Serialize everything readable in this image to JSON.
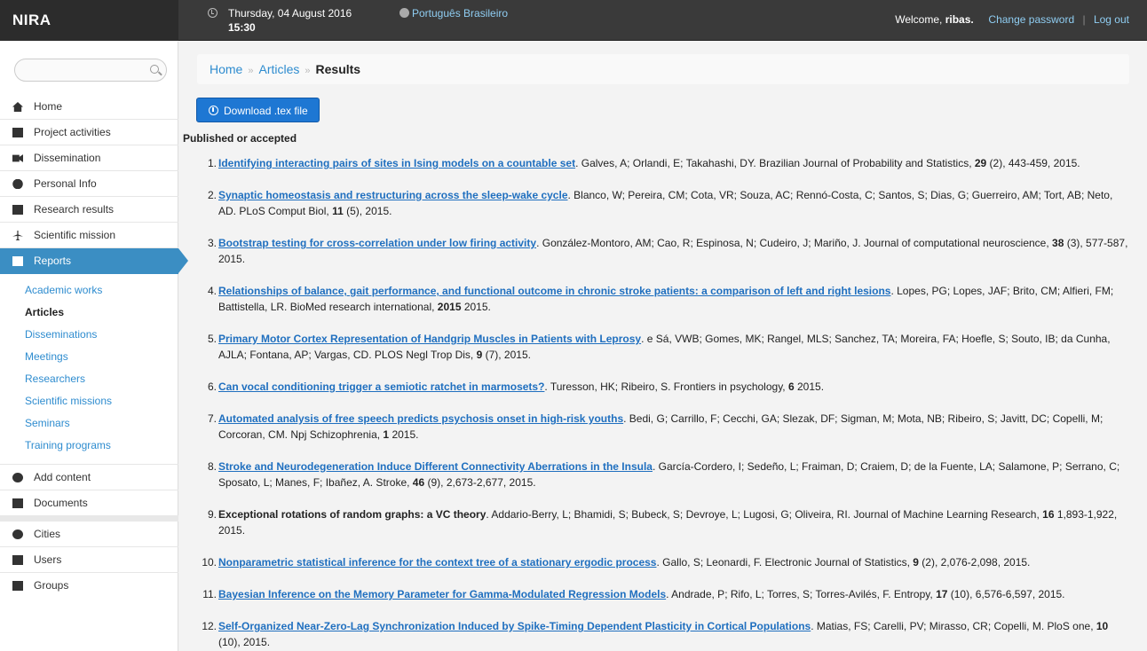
{
  "header": {
    "brand": "NIRA",
    "date": "Thursday, 04 August 2016",
    "time": "15:30",
    "language": "Português Brasileiro",
    "welcome": "Welcome,",
    "username": "ribas.",
    "change_password": "Change password",
    "separator": "|",
    "logout": "Log out"
  },
  "sidebar": {
    "search_placeholder": "",
    "items": [
      {
        "label": "Home",
        "icon": "home-icon"
      },
      {
        "label": "Project activities",
        "icon": "calendar-icon"
      },
      {
        "label": "Dissemination",
        "icon": "video-camera-icon"
      },
      {
        "label": "Personal Info",
        "icon": "user-icon"
      },
      {
        "label": "Research results",
        "icon": "book-icon"
      },
      {
        "label": "Scientific mission",
        "icon": "plane-icon"
      },
      {
        "label": "Reports",
        "icon": "grid-icon"
      }
    ],
    "sub_items": [
      "Academic works",
      "Articles",
      "Disseminations",
      "Meetings",
      "Researchers",
      "Scientific missions",
      "Seminars",
      "Training programs"
    ],
    "items2": [
      {
        "label": "Add content",
        "icon": "plus-circle-icon"
      },
      {
        "label": "Documents",
        "icon": "document-icon"
      }
    ],
    "items3": [
      {
        "label": "Cities",
        "icon": "globe-icon"
      },
      {
        "label": "Users",
        "icon": "briefcase-icon"
      },
      {
        "label": "Groups",
        "icon": "lock-icon"
      }
    ]
  },
  "breadcrumb": {
    "home": "Home",
    "articles": "Articles",
    "current": "Results",
    "arrow": "»"
  },
  "download_button": "Download .tex file",
  "section_title": "Published or accepted",
  "references": [
    {
      "num": "1.",
      "title": "Identifying interacting pairs of sites in Ising models on a countable set",
      "rest": ". Galves, A; Orlandi, E; Takahashi, DY. Brazilian Journal of Probability and Statistics, ",
      "vol": "29",
      "tail": " (2), 443-459, 2015."
    },
    {
      "num": "2.",
      "title": "Synaptic homeostasis and restructuring across the sleep-wake cycle",
      "rest": ". Blanco, W; Pereira, CM; Cota, VR; Souza, AC; Rennó-Costa, C; Santos, S; Dias, G; Guerreiro, AM; Tort, AB; Neto, AD. PLoS Comput Biol, ",
      "vol": "11",
      "tail": " (5), 2015."
    },
    {
      "num": "3.",
      "title": "Bootstrap testing for cross-correlation under low firing activity",
      "rest": ". González-Montoro, AM; Cao, R; Espinosa, N; Cudeiro, J; Mariño, J. Journal of computational neuroscience, ",
      "vol": "38",
      "tail": " (3), 577-587, 2015."
    },
    {
      "num": "4.",
      "title": "Relationships of balance, gait performance, and functional outcome in chronic stroke patients: a comparison of left and right lesions",
      "rest": ". Lopes, PG; Lopes, JAF; Brito, CM; Alfieri, FM; Battistella, LR. BioMed research international, ",
      "vol": "2015",
      "tail": " 2015."
    },
    {
      "num": "5.",
      "title": "Primary Motor Cortex Representation of Handgrip Muscles in Patients with Leprosy",
      "rest": ". e Sá, VWB; Gomes, MK; Rangel, MLS; Sanchez, TA; Moreira, FA; Hoefle, S; Souto, IB; da Cunha, AJLA; Fontana, AP; Vargas, CD. PLOS Negl Trop Dis, ",
      "vol": "9",
      "tail": " (7), 2015."
    },
    {
      "num": "6.",
      "title": "Can vocal conditioning trigger a semiotic ratchet in marmosets?",
      "rest": ". Turesson, HK; Ribeiro, S. Frontiers in psychology, ",
      "vol": "6",
      "tail": " 2015."
    },
    {
      "num": "7.",
      "title": "Automated analysis of free speech predicts psychosis onset in high-risk youths",
      "rest": ". Bedi, G; Carrillo, F; Cecchi, GA; Slezak, DF; Sigman, M; Mota, NB; Ribeiro, S; Javitt, DC; Copelli, M; Corcoran, CM. Npj Schizophrenia, ",
      "vol": "1",
      "tail": " 2015."
    },
    {
      "num": "8.",
      "title": "Stroke and Neurodegeneration Induce Different Connectivity Aberrations in the Insula",
      "rest": ". García-Cordero, I; Sedeño, L; Fraiman, D; Craiem, D; de la Fuente, LA; Salamone, P; Serrano, C; Sposato, L; Manes, F; Ibañez, A. Stroke, ",
      "vol": "46",
      "tail": " (9), 2,673-2,677, 2015."
    },
    {
      "num": "9.",
      "title": "Exceptional rotations of random graphs: a VC theory",
      "rest": ". Addario-Berry, L; Bhamidi, S; Bubeck, S; Devroye, L; Lugosi, G; Oliveira, RI. Journal of Machine Learning Research, ",
      "vol": "16",
      "tail": " 1,893-1,922, 2015.",
      "nolink": true
    },
    {
      "num": "10.",
      "title": "Nonparametric statistical inference for the context tree of a stationary ergodic process",
      "rest": ". Gallo, S; Leonardi, F. Electronic Journal of Statistics, ",
      "vol": "9",
      "tail": " (2), 2,076-2,098, 2015."
    },
    {
      "num": "11.",
      "title": "Bayesian Inference on the Memory Parameter for Gamma-Modulated Regression Models",
      "rest": ". Andrade, P; Rifo, L; Torres, S; Torres-Avilés, F. Entropy, ",
      "vol": "17",
      "tail": " (10), 6,576-6,597, 2015."
    },
    {
      "num": "12.",
      "title": "Self-Organized Near-Zero-Lag Synchronization Induced by Spike-Timing Dependent Plasticity in Cortical Populations",
      "rest": ". Matias, FS; Carelli, PV; Mirasso, CR; Copelli, M. PloS one, ",
      "vol": "10",
      "tail": " (10), 2015."
    }
  ]
}
